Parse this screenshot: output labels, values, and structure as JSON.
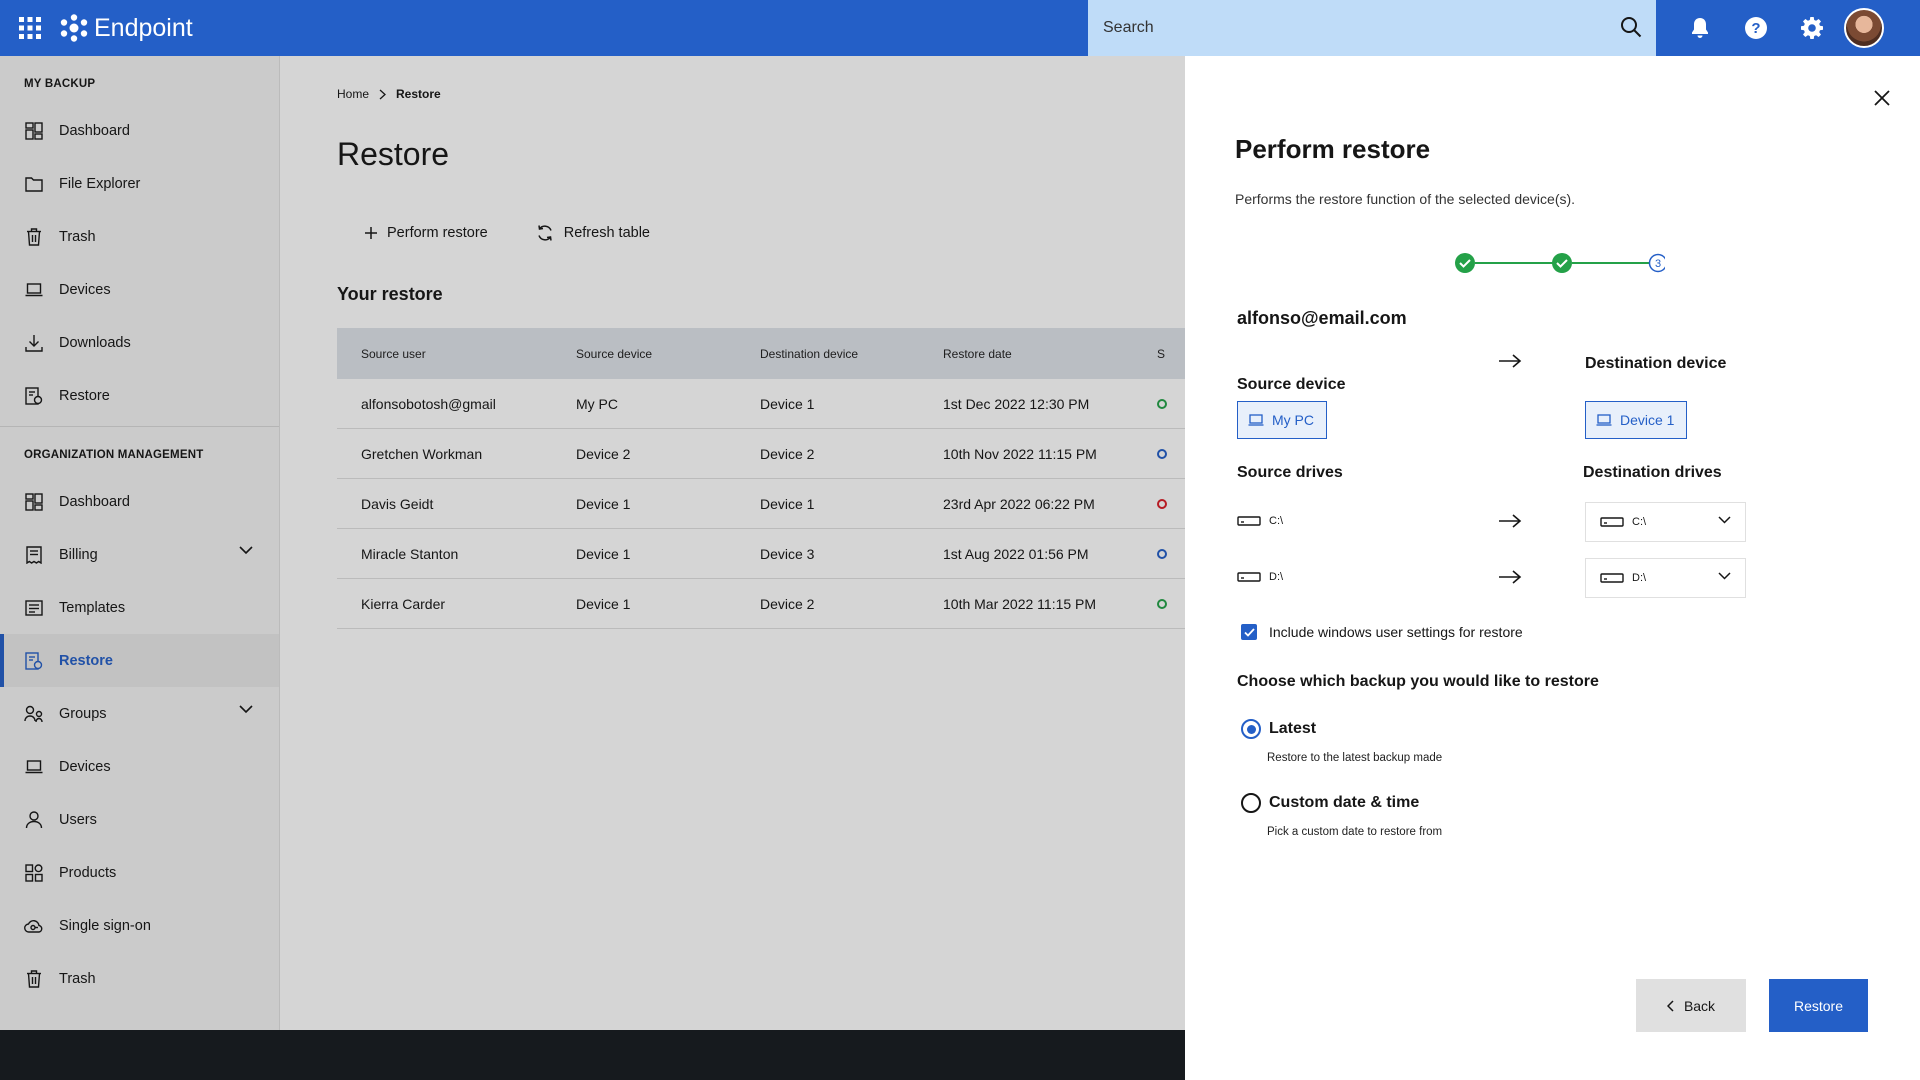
{
  "app": {
    "name": "Endpoint"
  },
  "search": {
    "placeholder": "Search"
  },
  "sidebar": {
    "my_backup_title": "MY BACKUP",
    "my_backup": [
      {
        "label": "Dashboard",
        "icon": "dashboard-icon"
      },
      {
        "label": "File Explorer",
        "icon": "folder-icon"
      },
      {
        "label": "Trash",
        "icon": "trash-icon"
      },
      {
        "label": "Devices",
        "icon": "laptop-icon"
      },
      {
        "label": "Downloads",
        "icon": "download-icon"
      },
      {
        "label": "Restore",
        "icon": "restore-icon"
      }
    ],
    "org_title": "ORGANIZATION MANAGEMENT",
    "org": [
      {
        "label": "Dashboard",
        "icon": "dashboard-icon"
      },
      {
        "label": "Billing",
        "icon": "billing-icon"
      },
      {
        "label": "Templates",
        "icon": "template-icon"
      },
      {
        "label": "Restore",
        "icon": "restore-icon",
        "active": true
      },
      {
        "label": "Groups",
        "icon": "groups-icon"
      },
      {
        "label": "Devices",
        "icon": "laptop-icon"
      },
      {
        "label": "Users",
        "icon": "users-icon"
      },
      {
        "label": "Products",
        "icon": "products-icon"
      },
      {
        "label": "Single sign-on",
        "icon": "sso-icon"
      },
      {
        "label": "Trash",
        "icon": "trash-icon"
      }
    ]
  },
  "breadcrumb": {
    "home": "Home",
    "current": "Restore"
  },
  "main": {
    "title": "Restore",
    "perform_restore": "Perform restore",
    "refresh_table": "Refresh table",
    "section_title": "Your restore",
    "columns": [
      "Source user",
      "Source device",
      "Destination device",
      "Restore date",
      "S"
    ],
    "rows": [
      {
        "user": "alfonsobotosh@gmail",
        "src": "My PC",
        "dst": "Device 1",
        "date": "1st Dec 2022  12:30 PM",
        "status_color": "#24a148"
      },
      {
        "user": "Gretchen Workman",
        "src": "Device 2",
        "dst": "Device 2",
        "date": "10th Nov 2022  11:15 PM",
        "status_color": "#245fc7"
      },
      {
        "user": "Davis Geidt",
        "src": "Device 1",
        "dst": "Device 1",
        "date": "23rd Apr 2022  06:22 PM",
        "status_color": "#da1e28"
      },
      {
        "user": "Miracle Stanton",
        "src": "Device 1",
        "dst": "Device 3",
        "date": "1st Aug 2022  01:56 PM",
        "status_color": "#245fc7"
      },
      {
        "user": "Kierra Carder",
        "src": "Device 1",
        "dst": "Device 2",
        "date": "10th Mar 2022  11:15 PM",
        "status_color": "#24a148"
      }
    ]
  },
  "panel": {
    "title": "Perform restore",
    "description": "Performs the restore function of the selected device(s).",
    "stepper": {
      "steps": 3,
      "current": 3,
      "current_label": "3"
    },
    "email": "alfonso@email.com",
    "source_device_label": "Source device",
    "destination_device_label": "Destination device",
    "source_device": "My PC",
    "destination_device": "Device 1",
    "source_drives_label": "Source drives",
    "destination_drives_label": "Destination drives",
    "drives": [
      {
        "source": "C:\\",
        "destination": "C:\\"
      },
      {
        "source": "D:\\",
        "destination": "D:\\"
      }
    ],
    "include_settings": "Include windows user settings for restore",
    "include_checked": true,
    "choose_title": "Choose which backup you would like to restore",
    "option_latest": "Latest",
    "option_latest_help": "Restore to the latest backup made",
    "option_custom": "Custom date & time",
    "option_custom_help": "Pick a custom date to restore from",
    "selected_option": "Latest",
    "back": "Back",
    "restore": "Restore"
  },
  "colors": {
    "brand": "#245fc7",
    "search_bg": "#bfdcf8",
    "success": "#24a148"
  }
}
